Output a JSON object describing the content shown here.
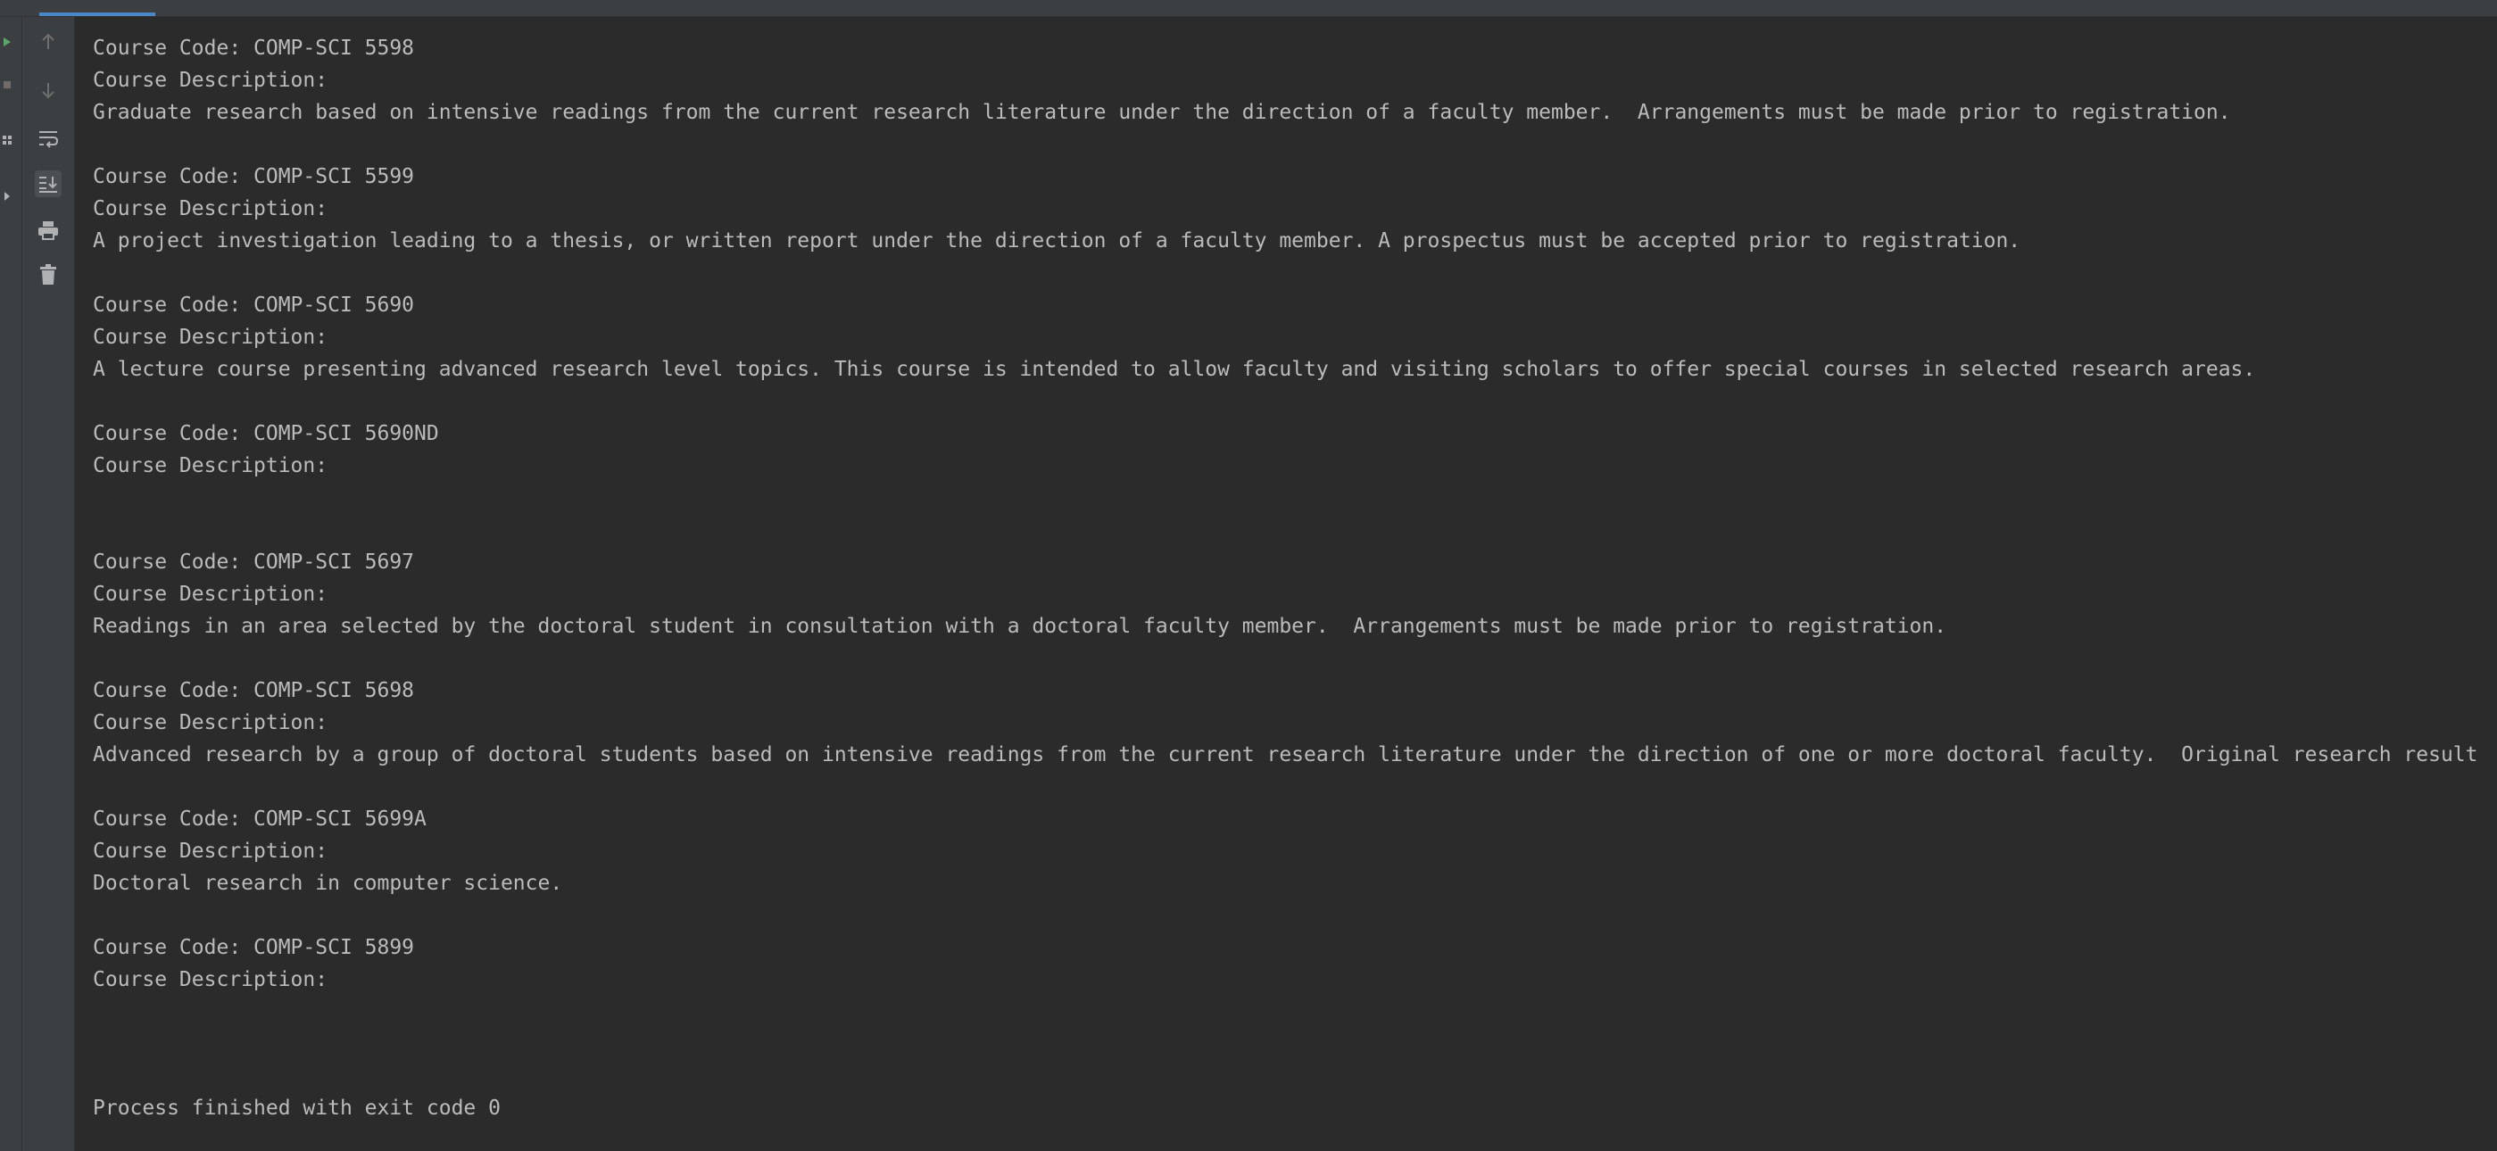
{
  "toolbar": {
    "icons": [
      "up-arrow-icon",
      "down-arrow-icon",
      "soft-wrap-icon",
      "scroll-to-end-icon",
      "print-icon",
      "trash-icon"
    ]
  },
  "colors": {
    "background": "#2b2b2b",
    "toolbar": "#3c3f41",
    "text": "#bbbbbb",
    "accent": "#4a88c7"
  },
  "console": {
    "lines": [
      "Course Code: COMP-SCI 5598",
      "Course Description:",
      "Graduate research based on intensive readings from the current research literature under the direction of a faculty member.  Arrangements must be made prior to registration.",
      "",
      "Course Code: COMP-SCI 5599",
      "Course Description:",
      "A project investigation leading to a thesis, or written report under the direction of a faculty member. A prospectus must be accepted prior to registration.",
      "",
      "Course Code: COMP-SCI 5690",
      "Course Description:",
      "A lecture course presenting advanced research level topics. This course is intended to allow faculty and visiting scholars to offer special courses in selected research areas.",
      "",
      "Course Code: COMP-SCI 5690ND",
      "Course Description:",
      "",
      "",
      "Course Code: COMP-SCI 5697",
      "Course Description:",
      "Readings in an area selected by the doctoral student in consultation with a doctoral faculty member.  Arrangements must be made prior to registration.",
      "",
      "Course Code: COMP-SCI 5698",
      "Course Description:",
      "Advanced research by a group of doctoral students based on intensive readings from the current research literature under the direction of one or more doctoral faculty.  Original research result",
      "",
      "Course Code: COMP-SCI 5699A",
      "Course Description:",
      "Doctoral research in computer science.",
      "",
      "Course Code: COMP-SCI 5899",
      "Course Description:",
      "",
      "",
      "",
      "Process finished with exit code 0"
    ]
  }
}
